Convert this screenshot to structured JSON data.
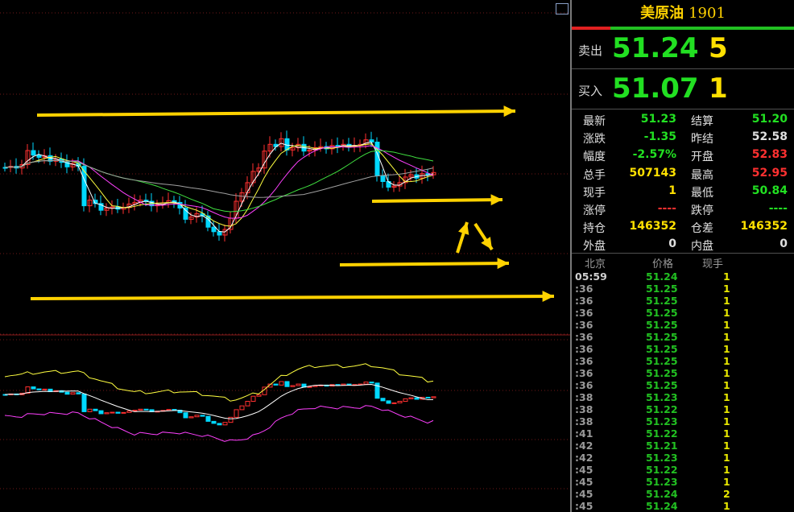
{
  "header": {
    "name": "美原油",
    "code": "1901"
  },
  "quote": {
    "ask_label": "卖出",
    "ask_price": "51.24",
    "ask_vol": "5",
    "bid_label": "买入",
    "bid_price": "51.07",
    "bid_vol": "1"
  },
  "stats": [
    {
      "l1": "最新",
      "v1": "51.23",
      "c1": "#22e022",
      "l2": "结算",
      "v2": "51.20",
      "c2": "#22e022"
    },
    {
      "l1": "涨跌",
      "v1": "-1.35",
      "c1": "#22e022",
      "l2": "昨结",
      "v2": "52.58",
      "c2": "#e0e0e0"
    },
    {
      "l1": "幅度",
      "v1": "-2.57%",
      "c1": "#22e022",
      "l2": "开盘",
      "v2": "52.83",
      "c2": "#ff3030"
    },
    {
      "l1": "总手",
      "v1": "507143",
      "c1": "#ffe000",
      "l2": "最高",
      "v2": "52.95",
      "c2": "#ff3030"
    },
    {
      "l1": "现手",
      "v1": "1",
      "c1": "#ffe000",
      "l2": "最低",
      "v2": "50.84",
      "c2": "#22e022"
    },
    {
      "l1": "涨停",
      "v1": "----",
      "c1": "#ff3030",
      "l2": "跌停",
      "v2": "----",
      "c2": "#22e022"
    },
    {
      "l1": "持仓",
      "v1": "146352",
      "c1": "#ffe000",
      "l2": "仓差",
      "v2": "146352",
      "c2": "#ffe000"
    },
    {
      "l1": "外盘",
      "v1": "0",
      "c1": "#e0e0e0",
      "l2": "内盘",
      "v2": "0",
      "c2": "#e0e0e0"
    }
  ],
  "ticks_header": {
    "time": "北京",
    "price": "价格",
    "vol": "现手"
  },
  "ticks": [
    {
      "t": "05:59",
      "p": "51.24",
      "v": "1"
    },
    {
      "t": ":36",
      "p": "51.25",
      "v": "1"
    },
    {
      "t": ":36",
      "p": "51.25",
      "v": "1"
    },
    {
      "t": ":36",
      "p": "51.25",
      "v": "1"
    },
    {
      "t": ":36",
      "p": "51.25",
      "v": "1"
    },
    {
      "t": ":36",
      "p": "51.25",
      "v": "1"
    },
    {
      "t": ":36",
      "p": "51.25",
      "v": "1"
    },
    {
      "t": ":36",
      "p": "51.25",
      "v": "1"
    },
    {
      "t": ":36",
      "p": "51.25",
      "v": "1"
    },
    {
      "t": ":36",
      "p": "51.25",
      "v": "1"
    },
    {
      "t": ":38",
      "p": "51.23",
      "v": "1"
    },
    {
      "t": ":38",
      "p": "51.22",
      "v": "1"
    },
    {
      "t": ":38",
      "p": "51.23",
      "v": "1"
    },
    {
      "t": ":41",
      "p": "51.22",
      "v": "1"
    },
    {
      "t": ":42",
      "p": "51.21",
      "v": "1"
    },
    {
      "t": ":42",
      "p": "51.23",
      "v": "1"
    },
    {
      "t": ":45",
      "p": "51.22",
      "v": "1"
    },
    {
      "t": ":45",
      "p": "51.23",
      "v": "1"
    },
    {
      "t": ":45",
      "p": "51.24",
      "v": "2"
    },
    {
      "t": ":45",
      "p": "51.24",
      "v": "1"
    }
  ],
  "colors": {
    "up": "#ff3030",
    "down": "#00d8ff",
    "annotation": "#ffd200"
  }
}
